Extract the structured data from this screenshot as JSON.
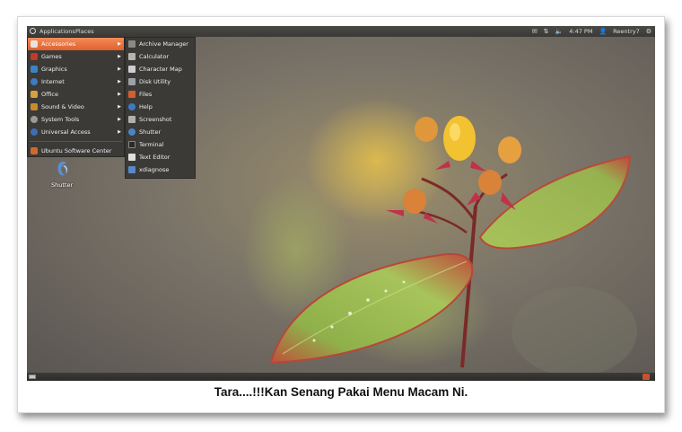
{
  "top_panel": {
    "applications_label": "Applications",
    "places_label": "Places",
    "time": "4:47 PM",
    "user": "Reentry7"
  },
  "apps_menu": {
    "items": [
      {
        "label": "Accessories",
        "icon": "accessories-icon",
        "color": "#e8622c",
        "submenu": true,
        "active": true
      },
      {
        "label": "Games",
        "icon": "games-icon",
        "color": "#c23a2a",
        "submenu": true
      },
      {
        "label": "Graphics",
        "icon": "graphics-icon",
        "color": "#3b84c4",
        "submenu": true
      },
      {
        "label": "Internet",
        "icon": "internet-icon",
        "color": "#3e7cc0",
        "submenu": true
      },
      {
        "label": "Office",
        "icon": "office-icon",
        "color": "#d8a13b",
        "submenu": true
      },
      {
        "label": "Sound & Video",
        "icon": "sound-video-icon",
        "color": "#c88a2e",
        "submenu": true
      },
      {
        "label": "System Tools",
        "icon": "system-tools-icon",
        "color": "#9a9a9a",
        "submenu": true
      },
      {
        "label": "Universal Access",
        "icon": "universal-access-icon",
        "color": "#3c6fb5",
        "submenu": true
      },
      {
        "label": "Ubuntu Software Center",
        "icon": "software-center-icon",
        "color": "#d06a2c",
        "submenu": false
      }
    ]
  },
  "sub_menu": {
    "items": [
      {
        "label": "Archive Manager",
        "icon": "archive-icon",
        "color": "#8a8a82"
      },
      {
        "label": "Calculator",
        "icon": "calculator-icon",
        "color": "#b5b5b0"
      },
      {
        "label": "Character Map",
        "icon": "character-map-icon",
        "color": "#cfcfcf"
      },
      {
        "label": "Disk Utility",
        "icon": "disk-icon",
        "color": "#9ca0a8"
      },
      {
        "label": "Files",
        "icon": "files-icon",
        "color": "#d45e2c"
      },
      {
        "label": "Help",
        "icon": "help-icon",
        "color": "#3d7ac4"
      },
      {
        "label": "Screenshot",
        "icon": "screenshot-icon",
        "color": "#b0b0b0"
      },
      {
        "label": "Shutter",
        "icon": "shutter-icon",
        "color": "#4a84c8"
      },
      {
        "label": "Terminal",
        "icon": "terminal-icon",
        "color": "#2a2a2a"
      },
      {
        "label": "Text Editor",
        "icon": "text-editor-icon",
        "color": "#e0e0dc"
      },
      {
        "label": "xdiagnose",
        "icon": "xdiagnose-icon",
        "color": "#5a88c8"
      }
    ]
  },
  "desktop": {
    "shutter_label": "Shutter"
  },
  "caption": "Tara....!!!Kan Senang Pakai Menu Macam Ni."
}
